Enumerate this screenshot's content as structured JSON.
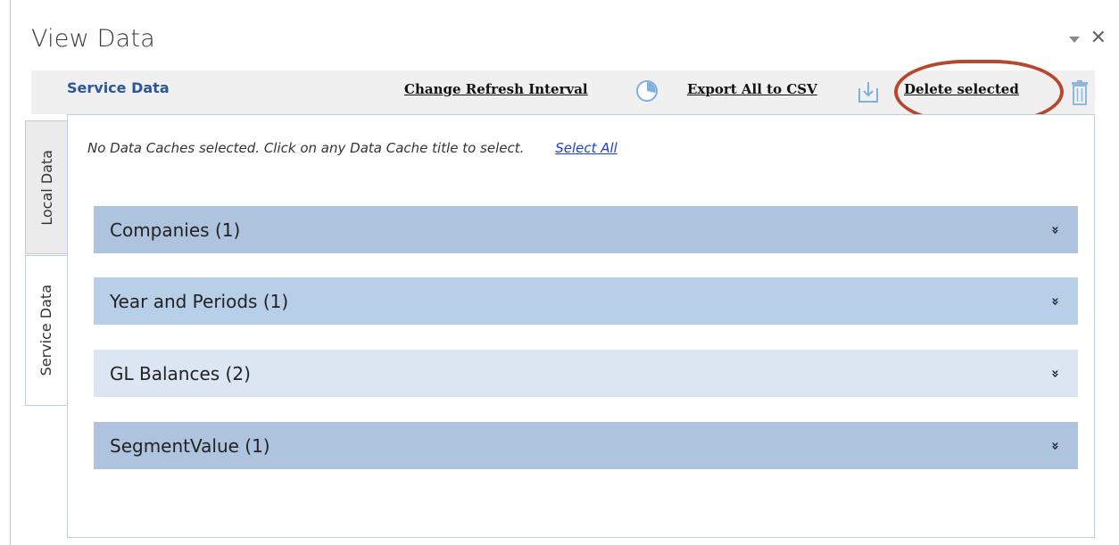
{
  "pane": {
    "title": "View Data",
    "dropdown_icon": "chevron-down-icon",
    "close_icon": "close-icon"
  },
  "header": {
    "section_title": "Service Data",
    "toolbar": {
      "refresh_label": "Change Refresh Interval",
      "refresh_icon": "clock-icon",
      "export_label": "Export All to CSV",
      "export_icon": "download-icon",
      "delete_label": "Delete selected",
      "delete_icon": "trash-icon"
    }
  },
  "tabs": [
    {
      "label": "Local Data",
      "active": false
    },
    {
      "label": "Service Data",
      "active": true
    }
  ],
  "info": {
    "message": "No Data Caches selected. Click on any Data Cache title to select.",
    "select_all_label": "Select All"
  },
  "caches": [
    {
      "label": "Companies (1)",
      "color": "#aec3dd"
    },
    {
      "label": "Year and Periods (1)",
      "color": "#b8cfe8"
    },
    {
      "label": "GL Balances (2)",
      "color": "#dce6f2"
    },
    {
      "label": "SegmentValue (1)",
      "color": "#aec3dd"
    }
  ],
  "colors": {
    "accent": "#2b5797",
    "highlight_ring": "#b5482e",
    "icon_blue": "#6fa8dc"
  }
}
